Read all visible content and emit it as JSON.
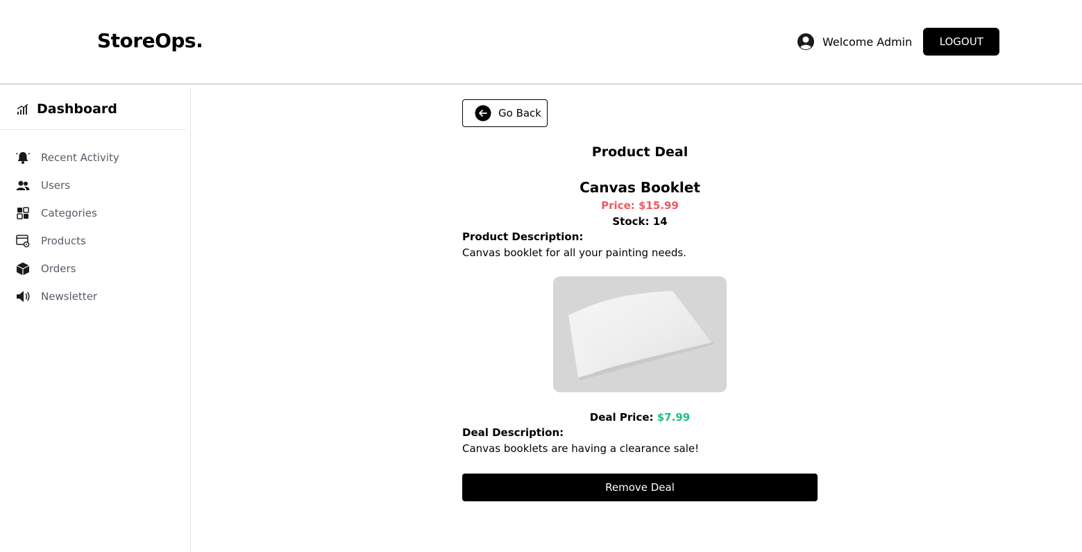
{
  "header": {
    "logo": "StoreOps.",
    "welcome": "Welcome Admin",
    "logout_label": "LOGOUT"
  },
  "sidebar": {
    "title": "Dashboard",
    "items": [
      {
        "label": "Recent Activity",
        "icon": "bell-icon"
      },
      {
        "label": "Users",
        "icon": "users-icon"
      },
      {
        "label": "Categories",
        "icon": "categories-icon"
      },
      {
        "label": "Products",
        "icon": "products-icon"
      },
      {
        "label": "Orders",
        "icon": "box-icon"
      },
      {
        "label": "Newsletter",
        "icon": "megaphone-icon"
      }
    ]
  },
  "main": {
    "go_back_label": "Go Back",
    "section_title": "Product Deal",
    "product": {
      "name": "Canvas Booklet",
      "price": "Price: $15.99",
      "stock": "Stock: 14",
      "description_label": "Product Description:",
      "description": "Canvas booklet for all your painting needs."
    },
    "deal": {
      "price_label": "Deal Price:",
      "price_value": "$7.99",
      "description_label": "Deal Description:",
      "description": "Canvas booklets are having a clearance sale!"
    },
    "remove_label": "Remove Deal"
  },
  "colors": {
    "price_red": "#f0595f",
    "deal_green": "#19c37d",
    "button_black": "#000000"
  }
}
